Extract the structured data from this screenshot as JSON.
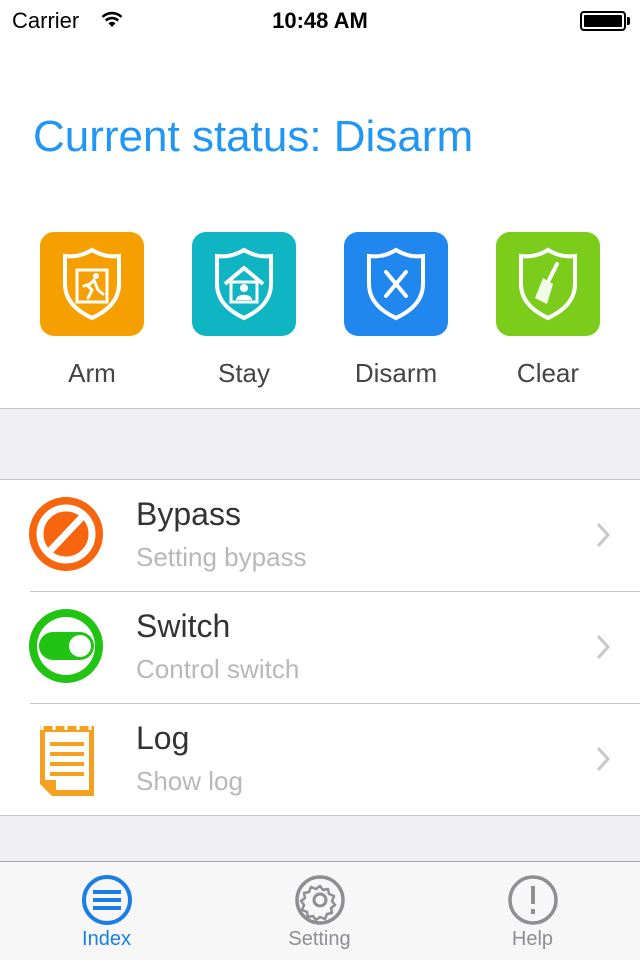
{
  "status_bar": {
    "carrier": "Carrier",
    "time": "10:48 AM",
    "wifi_icon": "wifi-icon",
    "battery_icon": "battery-full-icon"
  },
  "header": {
    "title": "Current status: Disarm"
  },
  "actions": [
    {
      "label": "Arm",
      "icon": "shield-exit-icon",
      "color": "#f5a000"
    },
    {
      "label": "Stay",
      "icon": "shield-home-icon",
      "color": "#0fb5c2"
    },
    {
      "label": "Disarm",
      "icon": "shield-x-icon",
      "color": "#1f87ee"
    },
    {
      "label": "Clear",
      "icon": "shield-broom-icon",
      "color": "#7ccc1c"
    }
  ],
  "menu": [
    {
      "title": "Bypass",
      "subtitle": "Setting bypass",
      "icon": "prohibited-icon",
      "color": "#f8650f"
    },
    {
      "title": "Switch",
      "subtitle": "Control switch",
      "icon": "toggle-icon",
      "color": "#22c414"
    },
    {
      "title": "Log",
      "subtitle": "Show log",
      "icon": "notepad-icon",
      "color": "#f5a01e"
    }
  ],
  "tabbar": {
    "tabs": [
      {
        "label": "Index",
        "icon": "list-circle-icon",
        "active": true
      },
      {
        "label": "Setting",
        "icon": "gear-icon",
        "active": false
      },
      {
        "label": "Help",
        "icon": "exclamation-circle-icon",
        "active": false
      }
    ],
    "active_color": "#1a7ee6",
    "inactive_color": "#8e8e93"
  }
}
